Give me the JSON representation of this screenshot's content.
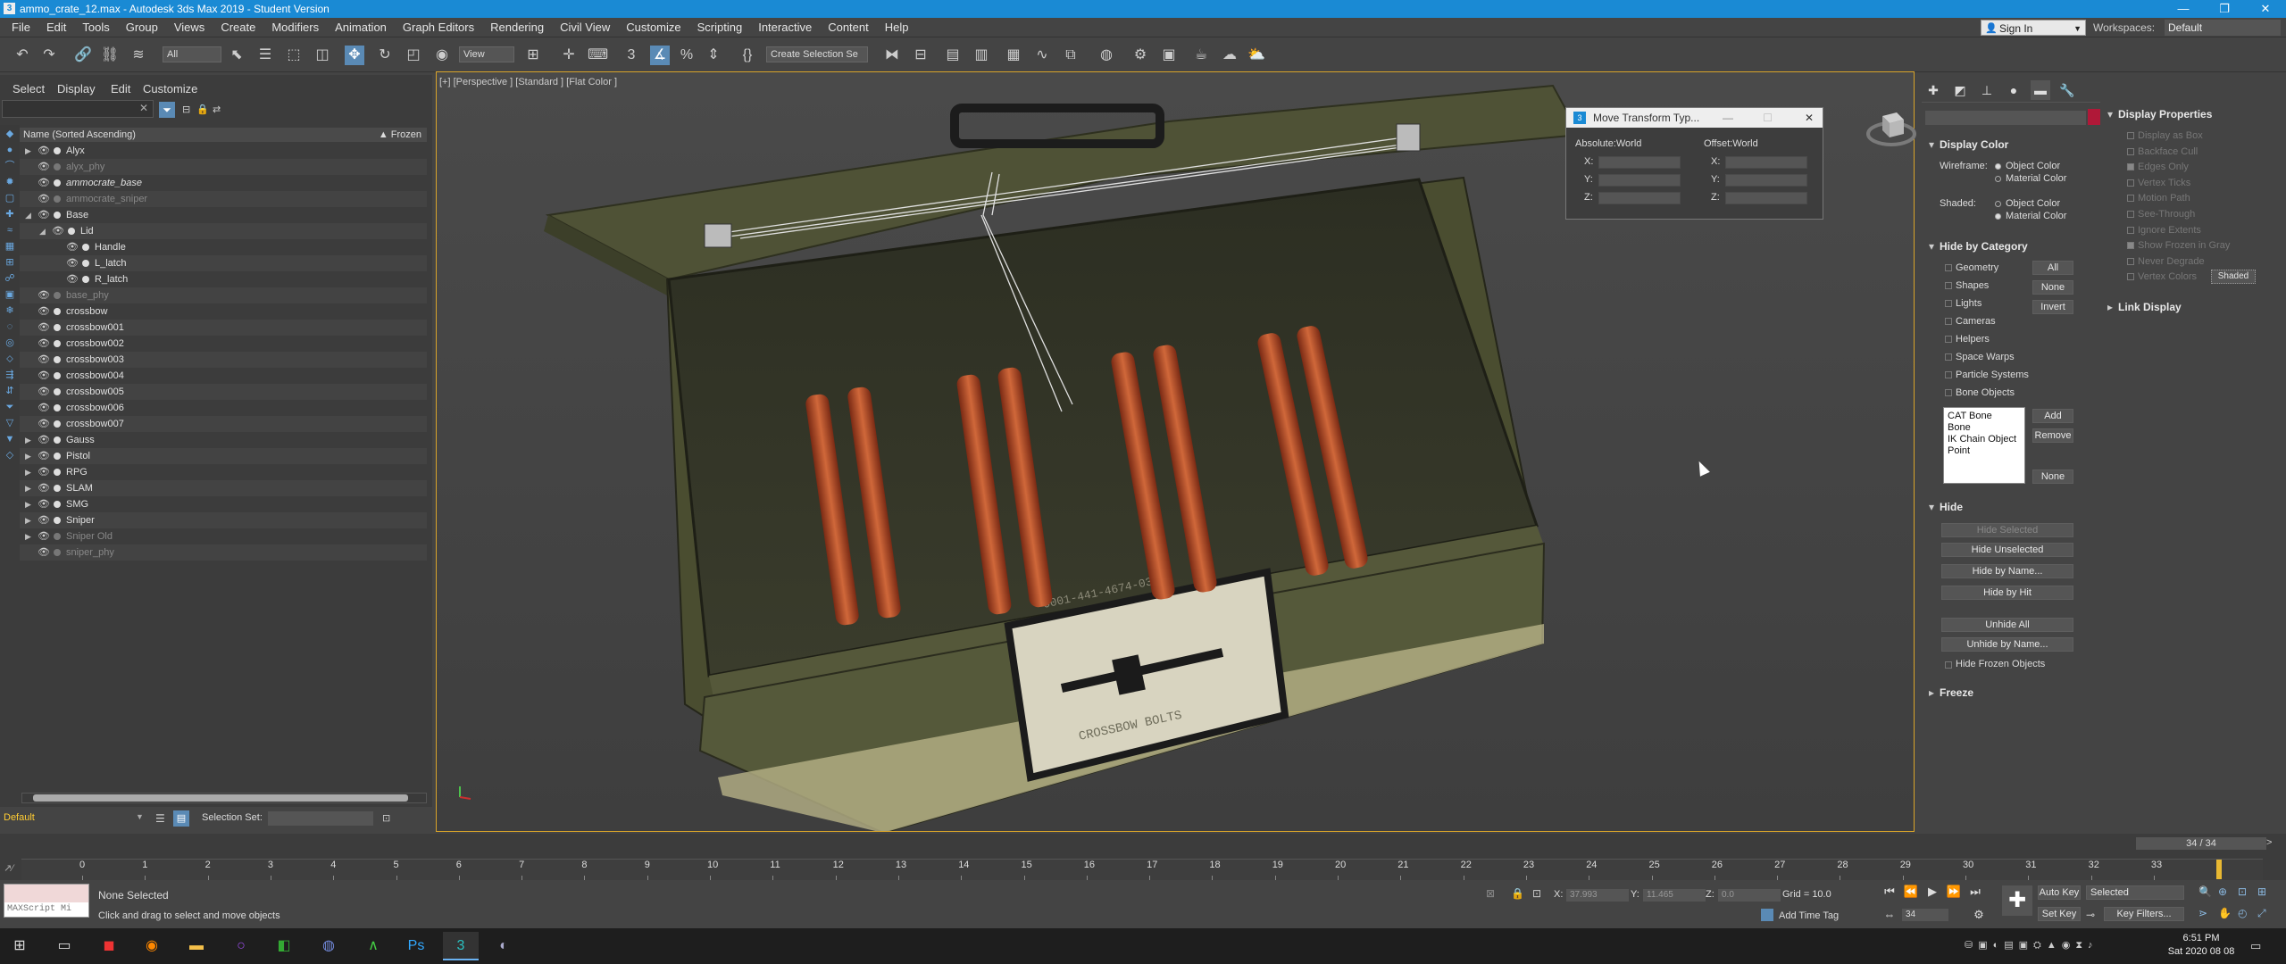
{
  "window": {
    "title": "ammo_crate_12.max - Autodesk 3ds Max 2019 - Student Version",
    "icon_label": "3"
  },
  "menubar": {
    "items": [
      "File",
      "Edit",
      "Tools",
      "Group",
      "Views",
      "Create",
      "Modifiers",
      "Animation",
      "Graph Editors",
      "Rendering",
      "Civil View",
      "Customize",
      "Scripting",
      "Interactive",
      "Content",
      "Help"
    ],
    "sign_in": "Sign In",
    "workspaces_label": "Workspaces:",
    "workspaces_value": "Default"
  },
  "toolbar": {
    "selection_filter": "All",
    "ref_coord": "View",
    "named_selection": "Create Selection Se"
  },
  "explorer": {
    "menu": [
      "Select",
      "Display",
      "Edit",
      "Customize"
    ],
    "col_name": "Name (Sorted Ascending)",
    "col_frozen": "▲ Frozen",
    "rows": [
      {
        "label": "Alyx",
        "indent": 0,
        "tri": "▶",
        "dim": false,
        "italic": false
      },
      {
        "label": "alyx_phy",
        "indent": 0,
        "tri": "",
        "dim": true,
        "italic": false
      },
      {
        "label": "ammocrate_base",
        "indent": 0,
        "tri": "",
        "dim": false,
        "italic": true
      },
      {
        "label": "ammocrate_sniper",
        "indent": 0,
        "tri": "",
        "dim": true,
        "italic": false
      },
      {
        "label": "Base",
        "indent": 0,
        "tri": "◢",
        "dim": false,
        "italic": false
      },
      {
        "label": "Lid",
        "indent": 1,
        "tri": "◢",
        "dim": false,
        "italic": false
      },
      {
        "label": "Handle",
        "indent": 2,
        "tri": "",
        "dim": false,
        "italic": false
      },
      {
        "label": "L_latch",
        "indent": 2,
        "tri": "",
        "dim": false,
        "italic": false
      },
      {
        "label": "R_latch",
        "indent": 2,
        "tri": "",
        "dim": false,
        "italic": false
      },
      {
        "label": "base_phy",
        "indent": 0,
        "tri": "",
        "dim": true,
        "italic": false
      },
      {
        "label": "crossbow",
        "indent": 0,
        "tri": "",
        "dim": false,
        "italic": false
      },
      {
        "label": "crossbow001",
        "indent": 0,
        "tri": "",
        "dim": false,
        "italic": false
      },
      {
        "label": "crossbow002",
        "indent": 0,
        "tri": "",
        "dim": false,
        "italic": false
      },
      {
        "label": "crossbow003",
        "indent": 0,
        "tri": "",
        "dim": false,
        "italic": false
      },
      {
        "label": "crossbow004",
        "indent": 0,
        "tri": "",
        "dim": false,
        "italic": false
      },
      {
        "label": "crossbow005",
        "indent": 0,
        "tri": "",
        "dim": false,
        "italic": false
      },
      {
        "label": "crossbow006",
        "indent": 0,
        "tri": "",
        "dim": false,
        "italic": false
      },
      {
        "label": "crossbow007",
        "indent": 0,
        "tri": "",
        "dim": false,
        "italic": false
      },
      {
        "label": "Gauss",
        "indent": 0,
        "tri": "▶",
        "dim": false,
        "italic": false
      },
      {
        "label": "Pistol",
        "indent": 0,
        "tri": "▶",
        "dim": false,
        "italic": false
      },
      {
        "label": "RPG",
        "indent": 0,
        "tri": "▶",
        "dim": false,
        "italic": false
      },
      {
        "label": "SLAM",
        "indent": 0,
        "tri": "▶",
        "dim": false,
        "italic": false
      },
      {
        "label": "SMG",
        "indent": 0,
        "tri": "▶",
        "dim": false,
        "italic": false
      },
      {
        "label": "Sniper",
        "indent": 0,
        "tri": "▶",
        "dim": false,
        "italic": false
      },
      {
        "label": "Sniper Old",
        "indent": 0,
        "tri": "▶",
        "dim": true,
        "italic": false
      },
      {
        "label": "sniper_phy",
        "indent": 0,
        "tri": "",
        "dim": true,
        "italic": false
      }
    ],
    "layer": "Default",
    "selection_set_label": "Selection Set:"
  },
  "viewport": {
    "label": "[+] [Perspective ] [Standard ] [Flat Color ]",
    "crate_text_top": "0001-441-4674-03",
    "crate_text_bottom": "CROSSBOW BOLTS"
  },
  "move_dialog": {
    "title": "Move Transform Typ...",
    "absolute": "Absolute:World",
    "offset": "Offset:World",
    "axes": [
      "X:",
      "Y:",
      "Z:"
    ]
  },
  "command_panel": {
    "display_color": {
      "title": "Display Color",
      "wireframe_label": "Wireframe:",
      "shaded_label": "Shaded:",
      "object_color": "Object Color",
      "material_color": "Material Color"
    },
    "hide_by_category": {
      "title": "Hide by Category",
      "items": [
        "Geometry",
        "Shapes",
        "Lights",
        "Cameras",
        "Helpers",
        "Space Warps",
        "Particle Systems",
        "Bone Objects"
      ],
      "btn_all": "All",
      "btn_none": "None",
      "btn_invert": "Invert",
      "list": [
        "CAT Bone",
        "Bone",
        "IK Chain Object",
        "Point"
      ],
      "btn_add": "Add",
      "btn_remove": "Remove",
      "btn_none2": "None"
    },
    "hide": {
      "title": "Hide",
      "buttons": [
        "Hide Selected",
        "Hide Unselected",
        "Hide by Name...",
        "Hide by Hit",
        "Unhide All",
        "Unhide by Name..."
      ],
      "hide_frozen": "Hide Frozen Objects"
    },
    "freeze_title": "Freeze",
    "display_properties": {
      "title": "Display Properties",
      "items": [
        {
          "label": "Display as Box",
          "checked": false
        },
        {
          "label": "Backface Cull",
          "checked": false
        },
        {
          "label": "Edges Only",
          "checked": true
        },
        {
          "label": "Vertex Ticks",
          "checked": false
        },
        {
          "label": "Motion Path",
          "checked": false
        },
        {
          "label": "See-Through",
          "checked": false
        },
        {
          "label": "Ignore Extents",
          "checked": false
        },
        {
          "label": "Show Frozen in Gray",
          "checked": true
        },
        {
          "label": "Never Degrade",
          "checked": false
        },
        {
          "label": "Vertex Colors",
          "checked": false
        }
      ],
      "shaded_btn": "Shaded"
    },
    "link_display_title": "Link Display"
  },
  "timeline": {
    "frame": "34 / 34",
    "ticks": [
      "0",
      "1",
      "2",
      "3",
      "4",
      "5",
      "6",
      "7",
      "8",
      "9",
      "10",
      "11",
      "12",
      "13",
      "14",
      "15",
      "16",
      "17",
      "18",
      "19",
      "20",
      "21",
      "22",
      "23",
      "24",
      "25",
      "26",
      "27",
      "28",
      "29",
      "30",
      "31",
      "32",
      "33"
    ],
    "current_frame": 34
  },
  "status": {
    "maxscript": "MAXScript Mi",
    "selection": "None Selected",
    "prompt": "Click and drag to select and move objects",
    "x_label": "X:",
    "x_value": "37.993",
    "y_label": "Y:",
    "y_value": "11.465",
    "z_label": "Z:",
    "z_value": "0.0",
    "grid": "Grid = 10.0",
    "add_time_tag": "Add Time Tag",
    "auto_key": "Auto Key",
    "set_key": "Set Key",
    "selected": "Selected",
    "key_filters": "Key Filters...",
    "frame_field": "34"
  },
  "taskbar": {
    "time": "6:51 PM",
    "date": "Sat 2020 08 08"
  }
}
